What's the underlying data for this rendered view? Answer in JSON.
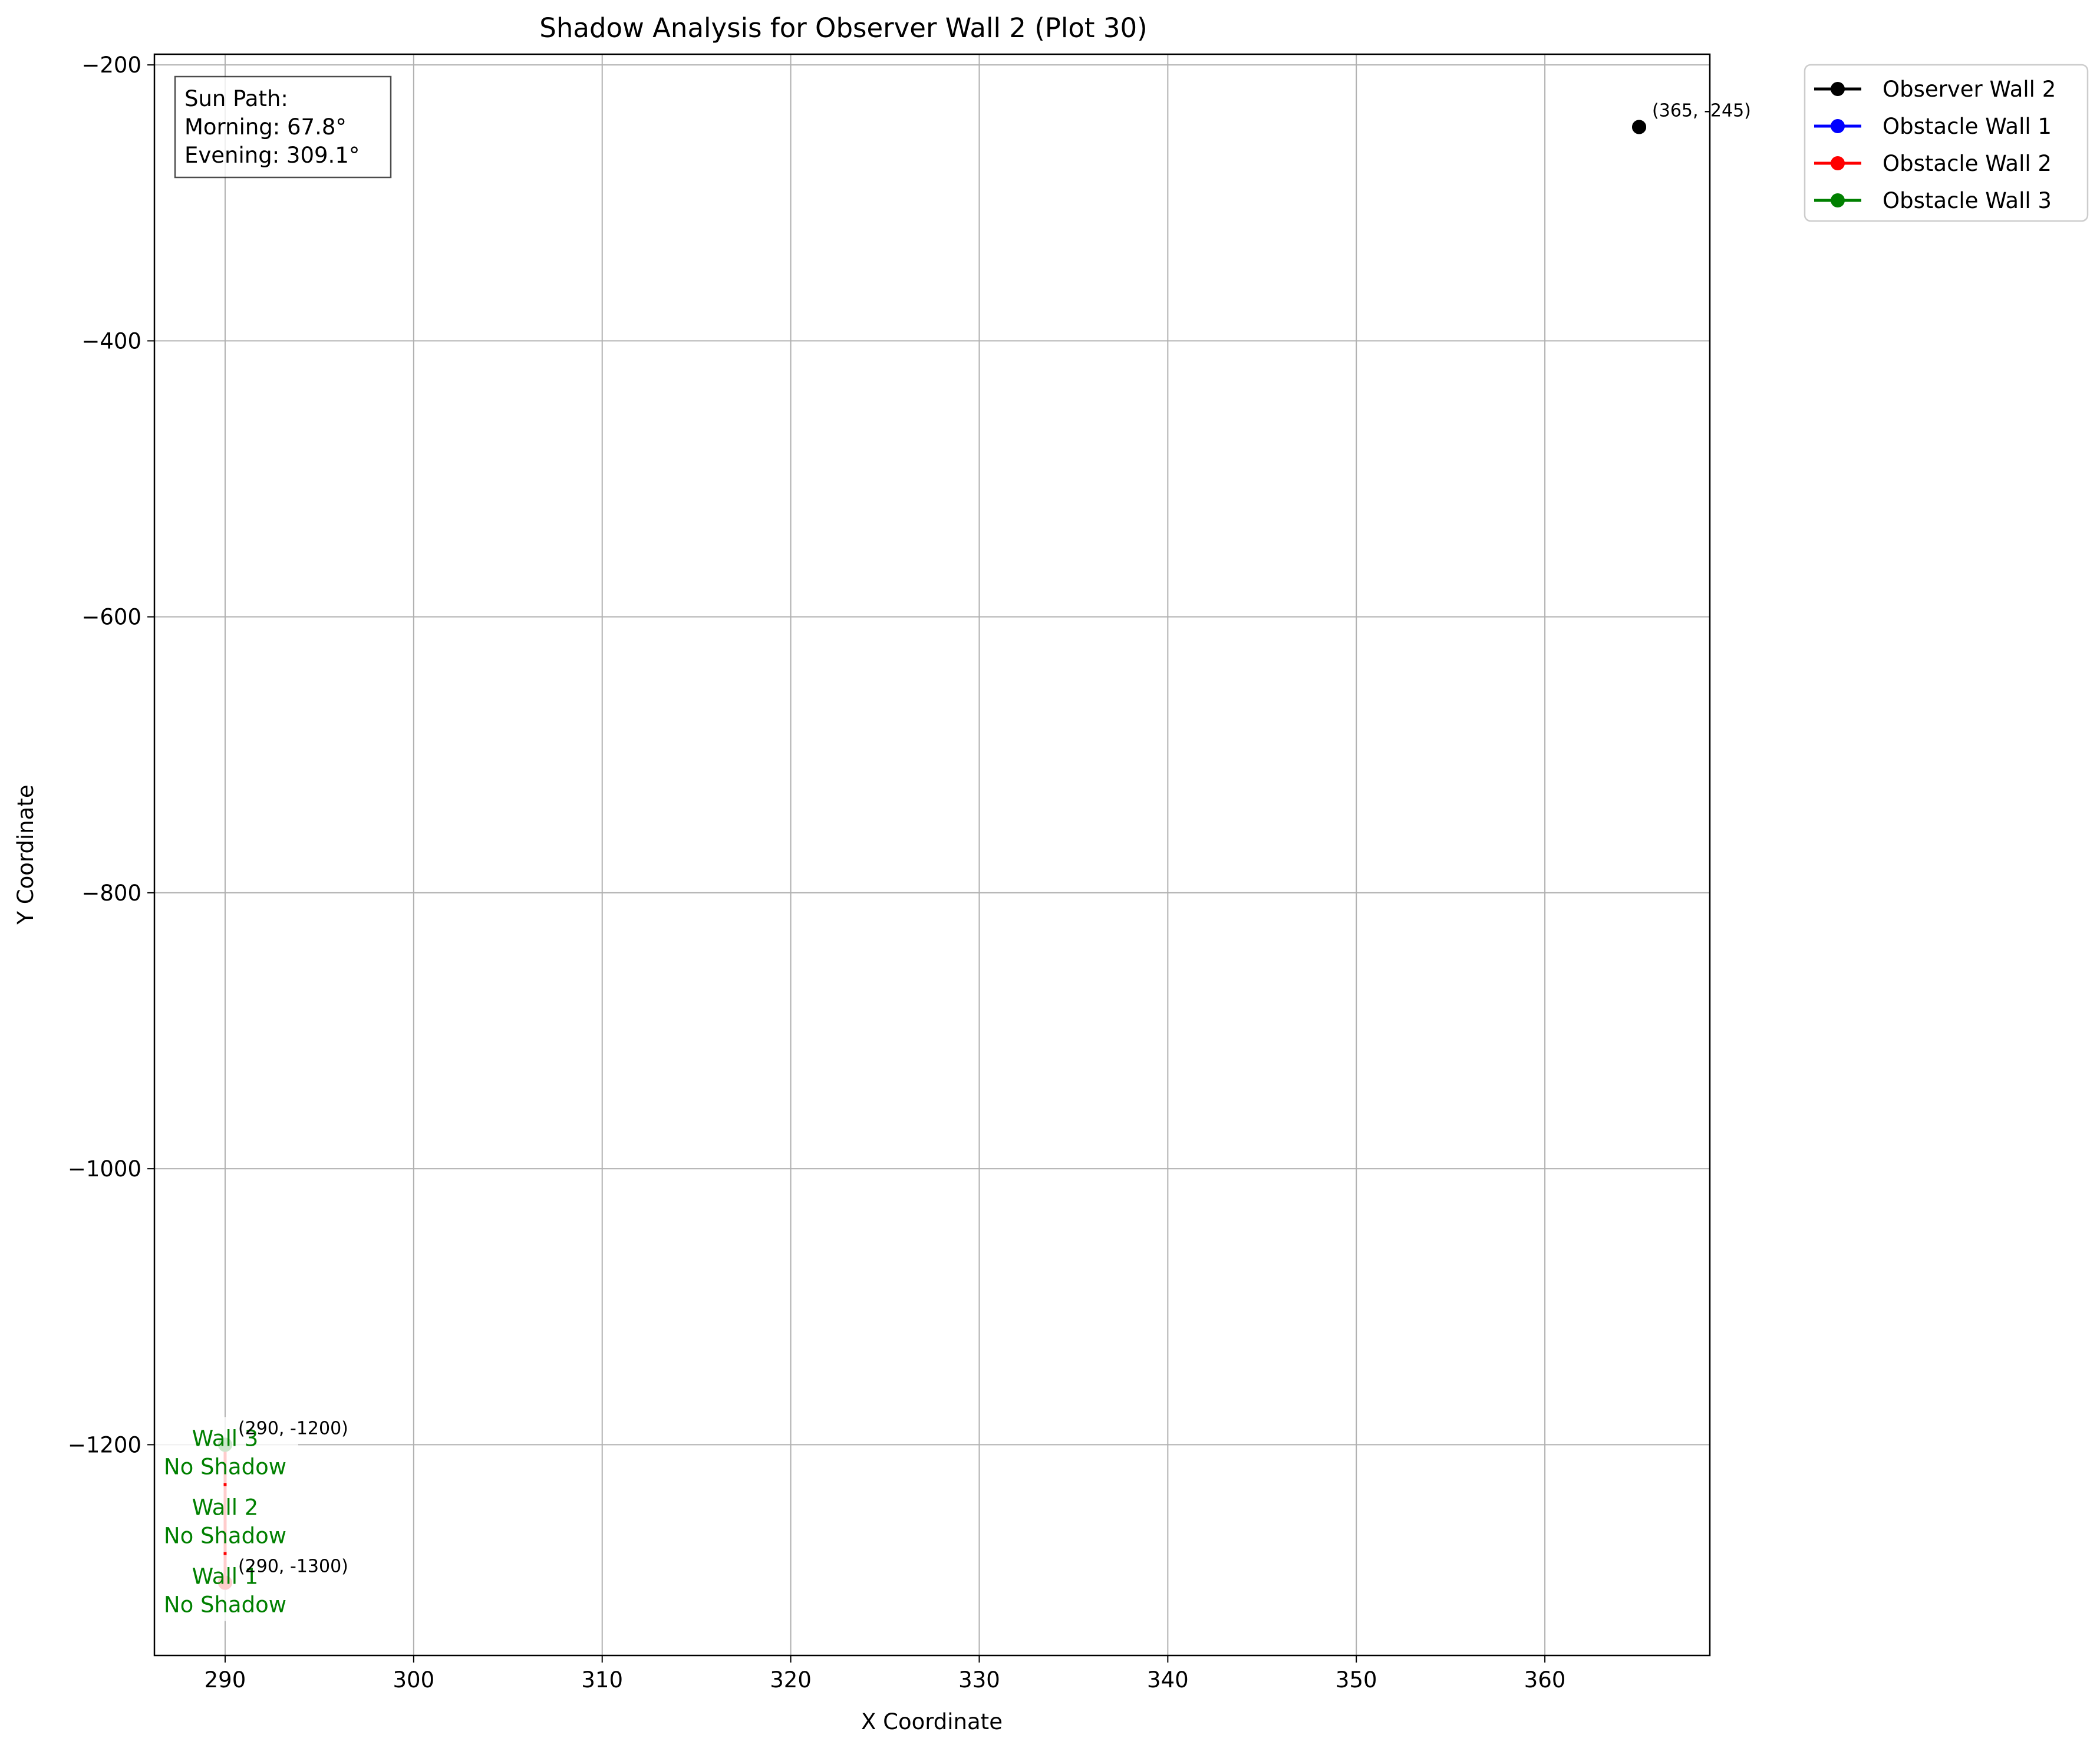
{
  "chart_data": {
    "type": "line",
    "title": "Shadow Analysis for Observer Wall 2 (Plot 30)",
    "xlabel": "X Coordinate",
    "ylabel": "Y Coordinate",
    "xlim": [
      286.25,
      368.75
    ],
    "ylim": [
      -1352.75,
      -192.25
    ],
    "xticks": [
      290,
      300,
      310,
      320,
      330,
      340,
      350,
      360
    ],
    "yticks": [
      -200,
      -400,
      -600,
      -800,
      -1000,
      -1200
    ],
    "xtick_labels": [
      "290",
      "300",
      "310",
      "320",
      "330",
      "340",
      "350",
      "360"
    ],
    "ytick_labels": [
      "−200",
      "−400",
      "−600",
      "−800",
      "−1000",
      "−1200"
    ],
    "grid": true,
    "legend_position": "outside-top-right",
    "series": [
      {
        "name": "Observer Wall 2",
        "color": "#000000",
        "points": [
          [
            365,
            -245
          ],
          [
            365,
            -245
          ]
        ]
      },
      {
        "name": "Obstacle Wall 1",
        "color": "#0000ff",
        "points": [
          [
            290,
            -1300
          ],
          [
            290,
            -1300
          ]
        ]
      },
      {
        "name": "Obstacle Wall 2",
        "color": "#ff0000",
        "points": [
          [
            290,
            -1300
          ],
          [
            290,
            -1200
          ]
        ]
      },
      {
        "name": "Obstacle Wall 3",
        "color": "#008000",
        "points": [
          [
            290,
            -1200
          ],
          [
            290,
            -1200
          ]
        ]
      }
    ],
    "point_annotations": [
      {
        "text": "(365, -245)",
        "x": 365,
        "y": -245
      },
      {
        "text": "(290, -1200)",
        "x": 290,
        "y": -1200
      },
      {
        "text": "(290, -1300)",
        "x": 290,
        "y": -1300
      }
    ],
    "wall_labels": [
      {
        "line1": "Wall 3",
        "line2": "No Shadow",
        "x": 290,
        "y": -1200,
        "color": "#008000"
      },
      {
        "line1": "Wall 2",
        "line2": "No Shadow",
        "x": 290,
        "y": -1250,
        "color": "#008000"
      },
      {
        "line1": "Wall 1",
        "line2": "No Shadow",
        "x": 290,
        "y": -1300,
        "color": "#008000"
      }
    ],
    "info_box": {
      "lines": [
        "Sun Path:",
        "Morning: 67.8°",
        "Evening: 309.1°"
      ]
    }
  }
}
